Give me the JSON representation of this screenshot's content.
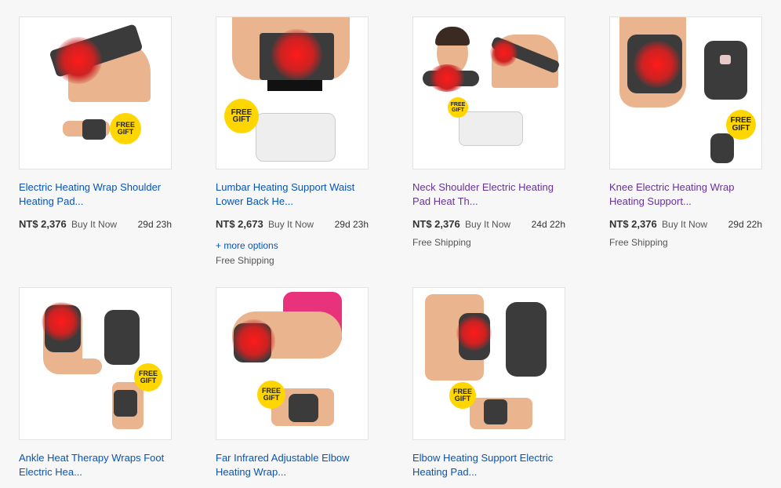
{
  "products": [
    {
      "title": "Electric Heating Wrap Shoulder Heating Pad...",
      "price": "NT$ 2,376",
      "buy": "Buy It Now",
      "time": "29d 23h",
      "options": "",
      "shipping": "",
      "gift": "FREE GIFT",
      "visited": false
    },
    {
      "title": "Lumbar Heating Support Waist Lower Back He...",
      "price": "NT$ 2,673",
      "buy": "Buy It Now",
      "time": "29d 23h",
      "options": "+ more options",
      "shipping": "Free Shipping",
      "gift": "FREE GIFT",
      "visited": false
    },
    {
      "title": "Neck Shoulder Electric Heating Pad Heat Th...",
      "price": "NT$ 2,376",
      "buy": "Buy It Now",
      "time": "24d 22h",
      "options": "",
      "shipping": "Free Shipping",
      "gift": "FREE GIFT",
      "visited": true
    },
    {
      "title": "Knee Electric Heating Wrap Heating Support...",
      "price": "NT$ 2,376",
      "buy": "Buy It Now",
      "time": "29d 22h",
      "options": "",
      "shipping": "Free Shipping",
      "gift": "FREE GIFT",
      "visited": true
    },
    {
      "title": "Ankle Heat Therapy Wraps Foot Electric Hea...",
      "gift": "FREE GIFT",
      "visited": false
    },
    {
      "title": "Far Infrared Adjustable Elbow Heating Wrap...",
      "gift": "FREE GIFT",
      "visited": false
    },
    {
      "title": "Elbow Heating Support Electric Heating Pad...",
      "gift": "FREE GIFT",
      "visited": false
    }
  ]
}
